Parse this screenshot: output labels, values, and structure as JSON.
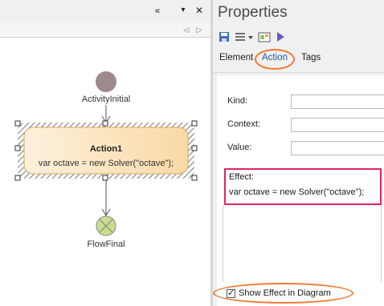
{
  "diagram": {
    "toolbar_icons": [
      "collapse-left-icon",
      "dropdown-icon",
      "close-icon"
    ],
    "nav_icons": [
      "nav-prev-icon",
      "nav-next-icon"
    ],
    "initial_node": {
      "label": "ActivityInitial"
    },
    "action": {
      "name": "Action1",
      "effect_text": "var octave = new Solver(\"octave\");"
    },
    "final_node": {
      "label": "FlowFinal"
    },
    "colors": {
      "initial": "#9e8a8a",
      "action_fill": "#fde9c8",
      "final": "#c7de8e"
    }
  },
  "properties": {
    "title": "Properties",
    "toolbar_icons": [
      "save-icon",
      "list-icon",
      "dropdown-icon",
      "diagram-icon",
      "play-icon"
    ],
    "tabs": [
      {
        "label": "Element"
      },
      {
        "label": "Action"
      },
      {
        "label": "Tags"
      }
    ],
    "fields": {
      "kind_label": "Kind:",
      "context_label": "Context:",
      "value_label": "Value:",
      "effect_label": "Effect:",
      "effect_value": "var octave = new Solver(\"octave\");"
    },
    "show_effect_label": "Show Effect in Diagram",
    "show_effect_checked": true,
    "colors": {
      "highlight_box": "#e0245e",
      "highlight_ring": "#f07a32",
      "active_tab": "#2255aa"
    }
  }
}
